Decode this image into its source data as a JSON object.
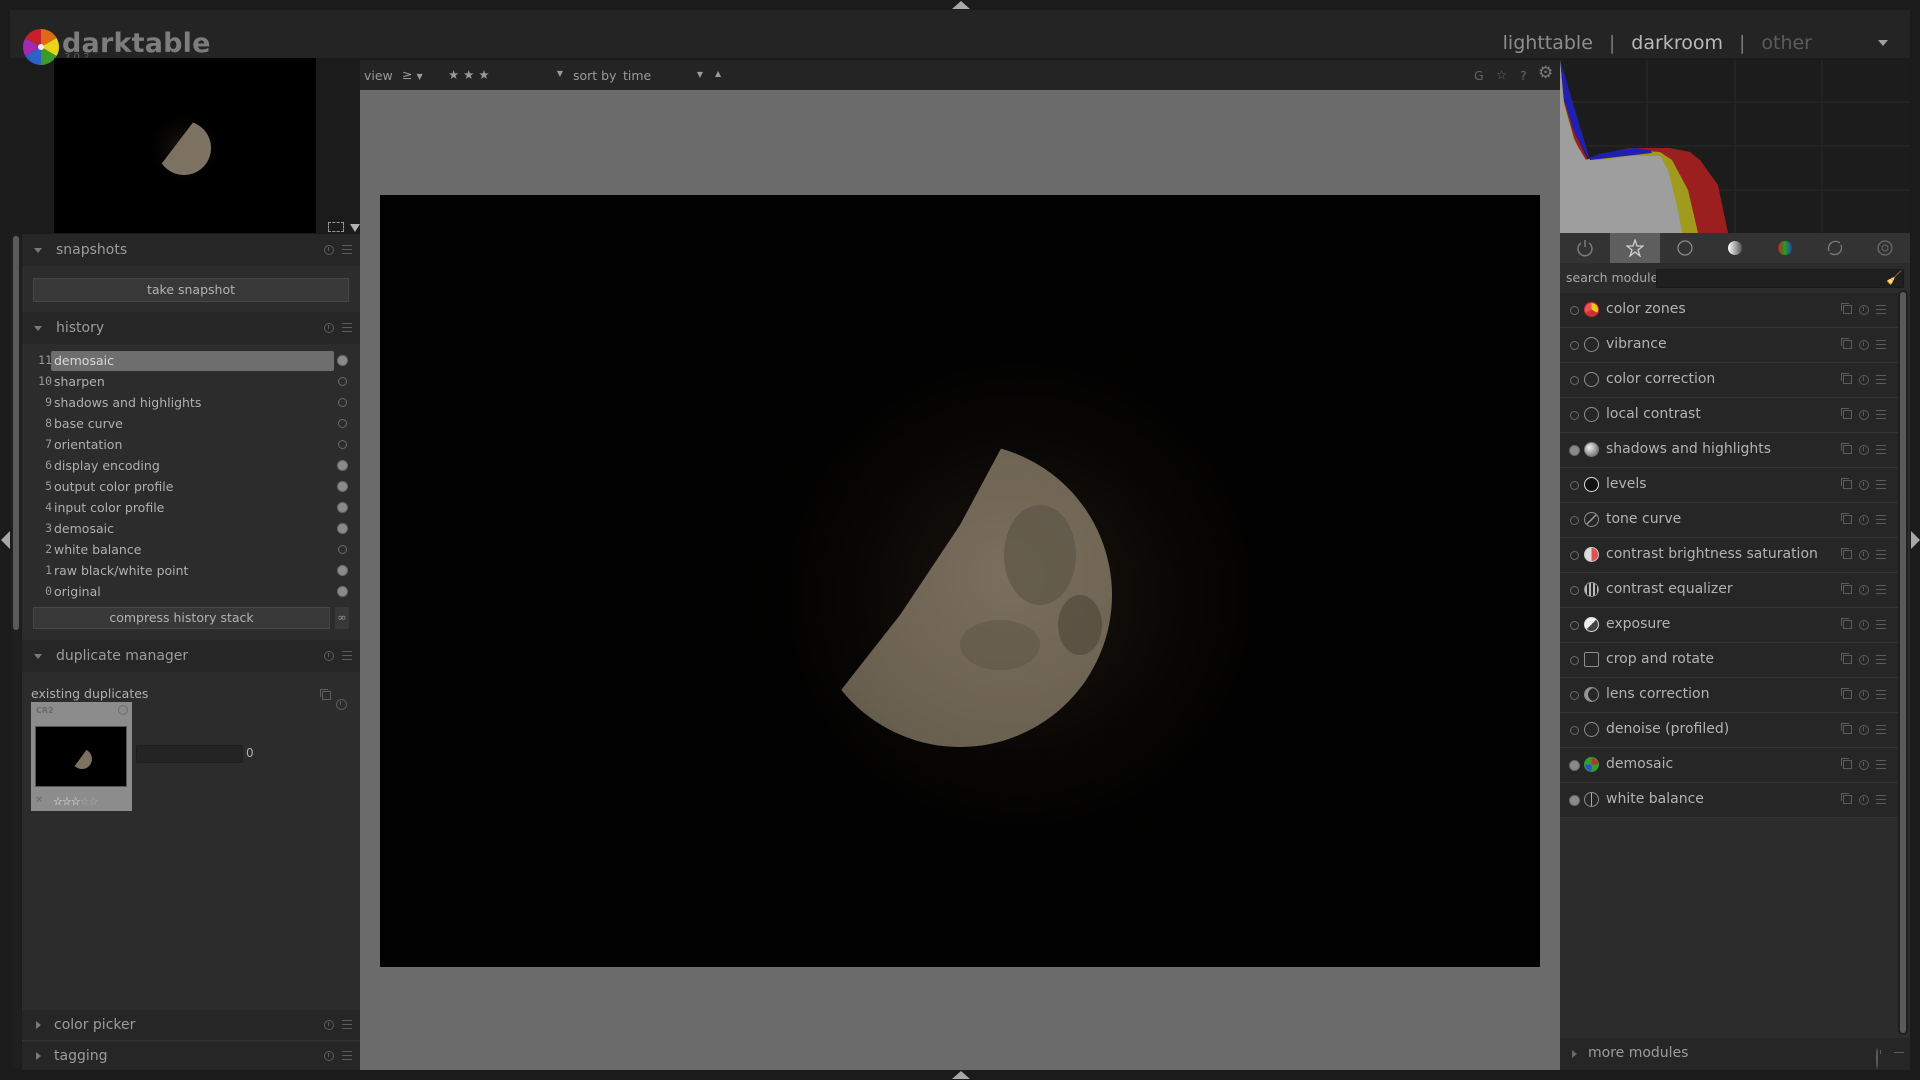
{
  "app": {
    "name": "darktable",
    "version": "3.0.2"
  },
  "view_switcher": {
    "items": [
      "lighttable",
      "darkroom",
      "other"
    ],
    "separator": "|",
    "active": "darkroom"
  },
  "center_toolbar": {
    "view_label": "view",
    "rating_comparator": "≥",
    "rating_value": "★ ★ ★",
    "sort_label": "sort by",
    "sort_value": "time",
    "sort_direction_icon": "▲",
    "right_icons": {
      "grouping": "G",
      "overlays": "☆",
      "help": "?",
      "preferences": "⚙"
    }
  },
  "left_panel": {
    "snapshots": {
      "title": "snapshots",
      "button": "take snapshot"
    },
    "history": {
      "title": "history",
      "items": [
        {
          "num": "11",
          "label": "demosaic",
          "selected": true,
          "enabled": true
        },
        {
          "num": "10",
          "label": "sharpen",
          "enabled": false
        },
        {
          "num": "9",
          "label": "shadows and highlights",
          "enabled": false
        },
        {
          "num": "8",
          "label": "base curve",
          "enabled": false
        },
        {
          "num": "7",
          "label": "orientation",
          "enabled": false
        },
        {
          "num": "6",
          "label": "display encoding",
          "enabled": true
        },
        {
          "num": "5",
          "label": "output color profile",
          "enabled": true
        },
        {
          "num": "4",
          "label": "input color profile",
          "enabled": true
        },
        {
          "num": "3",
          "label": "demosaic",
          "enabled": true
        },
        {
          "num": "2",
          "label": "white balance",
          "enabled": false
        },
        {
          "num": "1",
          "label": "raw black/white point",
          "enabled": true
        },
        {
          "num": "0",
          "label": "original",
          "enabled": true
        }
      ],
      "compress_button": "compress history stack"
    },
    "duplicate_manager": {
      "title": "duplicate manager",
      "subtitle": "existing duplicates",
      "thumb_ext": "CR2",
      "thumb_stars": "☆☆☆",
      "thumb_empty_stars": "☆☆",
      "thumb_reject": "✕",
      "version_value": "0",
      "rating": 3
    },
    "collapsed_modules": [
      "color picker",
      "tagging"
    ]
  },
  "right_panel": {
    "module_groups": [
      "active modules",
      "favourites",
      "basic",
      "tone",
      "color",
      "correct",
      "effect"
    ],
    "active_group_index": 1,
    "search_label": "search module",
    "search_value": "",
    "modules": [
      {
        "label": "color zones",
        "icon": "color-zones-icon",
        "enabled": false
      },
      {
        "label": "vibrance",
        "icon": "circle-icon",
        "enabled": false
      },
      {
        "label": "color correction",
        "icon": "circle-icon",
        "enabled": false
      },
      {
        "label": "local contrast",
        "icon": "circle-icon",
        "enabled": false
      },
      {
        "label": "shadows and highlights",
        "icon": "sphere-icon",
        "enabled": true
      },
      {
        "label": "levels",
        "icon": "levels-icon",
        "enabled": false
      },
      {
        "label": "tone curve",
        "icon": "tone-curve-icon",
        "enabled": false
      },
      {
        "label": "contrast brightness saturation",
        "icon": "cbs-icon",
        "enabled": false
      },
      {
        "label": "contrast equalizer",
        "icon": "equalizer-icon",
        "enabled": false
      },
      {
        "label": "exposure",
        "icon": "exposure-icon",
        "enabled": false
      },
      {
        "label": "crop and rotate",
        "icon": "crop-icon",
        "enabled": false
      },
      {
        "label": "lens correction",
        "icon": "lens-icon",
        "enabled": false
      },
      {
        "label": "denoise (profiled)",
        "icon": "circle-icon",
        "enabled": false
      },
      {
        "label": "demosaic",
        "icon": "demosaic-icon",
        "enabled": true
      },
      {
        "label": "white balance",
        "icon": "white-balance-icon",
        "enabled": true
      }
    ],
    "more_modules": "more modules"
  },
  "colors": {
    "background": "#1b1b1b",
    "panel": "#2c2c2c",
    "center_bg": "#6b6b6b",
    "selected": "#6e6e6e"
  }
}
